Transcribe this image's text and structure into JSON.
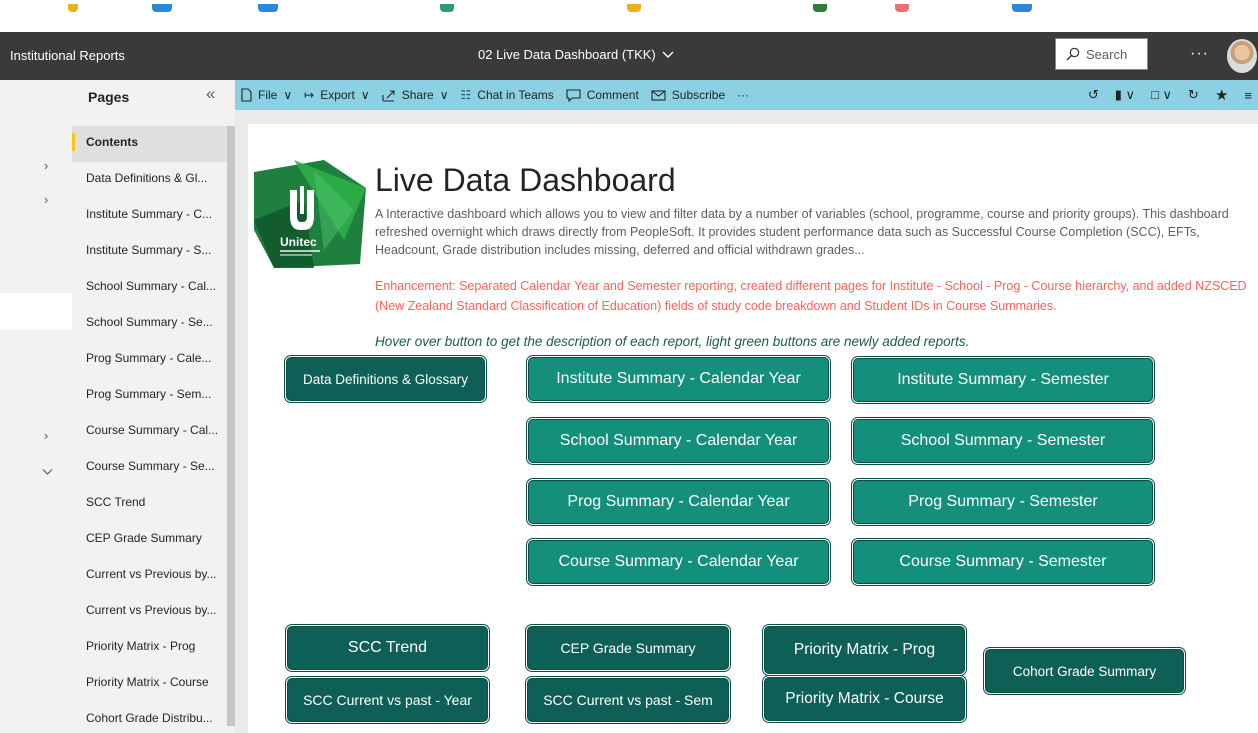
{
  "titlebar": {
    "app_name": "Institutional Reports",
    "report_title": "02 Live Data Dashboard (TKK)",
    "search_placeholder": "Search"
  },
  "pages_pane": {
    "header": "Pages",
    "items": [
      {
        "label": "Contents",
        "active": true
      },
      {
        "label": "Data Definitions & Gl..."
      },
      {
        "label": "Institute Summary - C..."
      },
      {
        "label": "Institute Summary - S..."
      },
      {
        "label": "School Summary - Cal..."
      },
      {
        "label": "School Summary - Se..."
      },
      {
        "label": "Prog Summary - Cale..."
      },
      {
        "label": "Prog Summary - Sem..."
      },
      {
        "label": "Course Summary - Cal..."
      },
      {
        "label": "Course Summary - Se..."
      },
      {
        "label": "SCC Trend"
      },
      {
        "label": "CEP Grade Summary"
      },
      {
        "label": "Current vs Previous by..."
      },
      {
        "label": "Current vs Previous by..."
      },
      {
        "label": "Priority Matrix - Prog"
      },
      {
        "label": "Priority Matrix - Course"
      },
      {
        "label": "Cohort Grade Distribu..."
      }
    ]
  },
  "toolbar": {
    "file": "File",
    "export": "Export",
    "share": "Share",
    "chat": "Chat in Teams",
    "comment": "Comment",
    "subscribe": "Subscribe"
  },
  "report": {
    "logo_text": "Unitec",
    "title": "Live Data Dashboard",
    "description": "A Interactive dashboard which allows you to view and filter data by a number of variables (school, programme, course and priority groups). This dashboard refreshed overnight which draws directly from PeopleSoft. It provides student performance data such as Successful Course Completion (SCC), EFTs, Headcount, Grade distribution includes missing, deferred and official withdrawn grades...",
    "enhancement": "Enhancement: Separated Calendar Year and Semester reporting, created different pages for Institute - School - Prog - Course hierarchy, and added NZSCED (New Zealand Standard Classification of Education) fields of study code breakdown and Student IDs in Course Summaries.",
    "hover_note": "Hover over button to get the description of each report, light green buttons are newly added reports.",
    "buttons": {
      "data_definitions": "Data Definitions & Glossary",
      "institute_cal": "Institute Summary - Calendar Year",
      "institute_sem": "Institute Summary - Semester",
      "school_cal": "School Summary - Calendar Year",
      "school_sem": "School Summary - Semester",
      "prog_cal": "Prog Summary - Calendar Year",
      "prog_sem": "Prog Summary - Semester",
      "course_cal": "Course Summary - Calendar Year",
      "course_sem": "Course Summary - Semester",
      "scc_trend": "SCC Trend",
      "cep_grade": "CEP Grade Summary",
      "priority_prog": "Priority Matrix - Prog",
      "cohort_grade": "Cohort Grade Summary",
      "scc_year": "SCC Current vs past - Year",
      "scc_sem": "SCC Current vs past - Sem",
      "priority_course": "Priority Matrix - Course"
    }
  },
  "colors": {
    "accent_teal_dark": "#0e5f55",
    "accent_teal_light": "#148f7c",
    "toolbar_bg": "#8bd0e3",
    "enhancement_text": "#fd625e"
  }
}
